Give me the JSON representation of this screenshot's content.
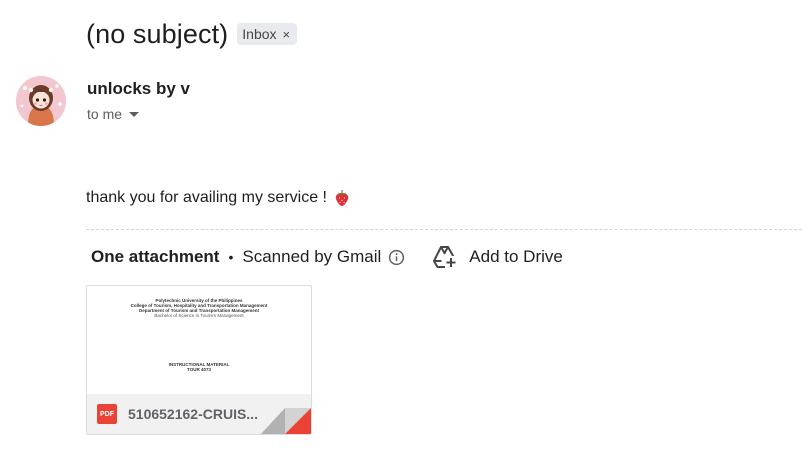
{
  "message": {
    "subject": "(no subject)",
    "label": "Inbox",
    "label_remove_symbol": "×",
    "sender": "unlocks by v",
    "recipient": "to me",
    "body": "thank you for availing my service !",
    "body_emoji": "strawberry-icon"
  },
  "attachments": {
    "title": "One attachment",
    "separator": "•",
    "scanned": "Scanned by Gmail",
    "add_to_drive": "Add to Drive",
    "file": {
      "type": "PDF",
      "name": "510652162-CRUIS...",
      "thumbnail_lines": [
        "Polytechnic University of the Philippines",
        "College of Tourism, Hospitality and Transportation Management",
        "Department of Tourism and Transportation Management",
        "Bachelor of Science in Tourism Management",
        "INSTRUCTIONAL MATERIAL",
        "TOUR 4073"
      ]
    }
  },
  "colors": {
    "pdf_red": "#ea4335",
    "chip_bg": "#e8eaed",
    "footer_bg": "#f1f1f1"
  }
}
